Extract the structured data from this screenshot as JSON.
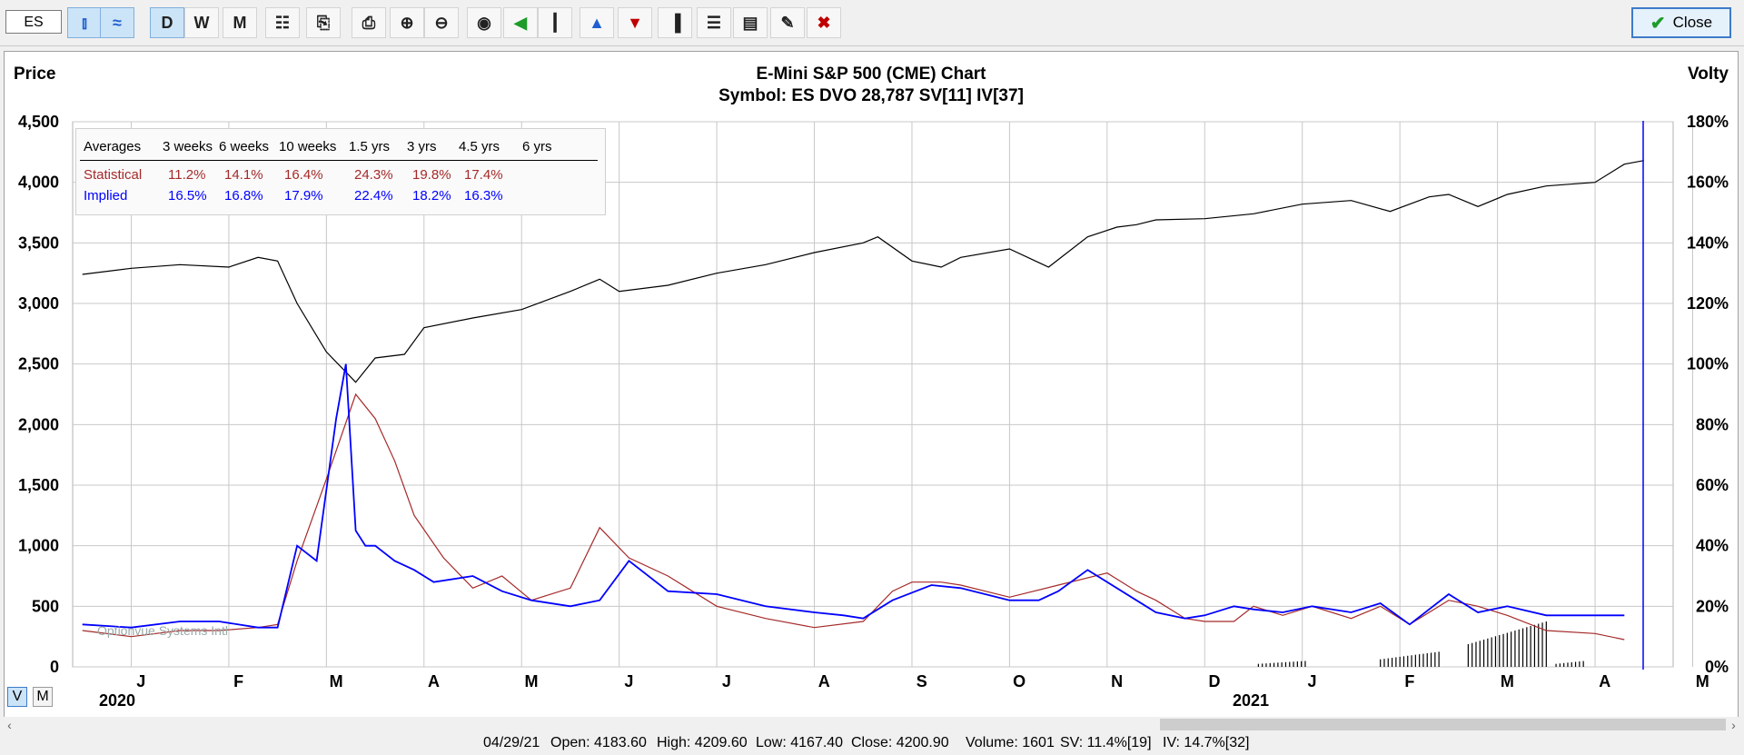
{
  "toolbar": {
    "symbol": "ES",
    "buttons": [
      {
        "name": "bar-chart-button",
        "glyph": "⫾",
        "selected": true
      },
      {
        "name": "line-chart-button",
        "glyph": "≈",
        "selected": true
      },
      {
        "name": "daily-button",
        "glyph": "D",
        "selected": true
      },
      {
        "name": "weekly-button",
        "glyph": "W",
        "selected": false
      },
      {
        "name": "monthly-button",
        "glyph": "M",
        "selected": false
      },
      {
        "name": "chart-settings-button",
        "glyph": "☷",
        "selected": false
      },
      {
        "name": "copy-button",
        "glyph": "⎘",
        "selected": false
      },
      {
        "name": "print-button",
        "glyph": "⎙",
        "selected": false
      },
      {
        "name": "zoom-in-button",
        "glyph": "⊕",
        "selected": false
      },
      {
        "name": "zoom-out-button",
        "glyph": "⊖",
        "selected": false
      },
      {
        "name": "target-button",
        "glyph": "◉",
        "selected": false
      },
      {
        "name": "arrow-button",
        "glyph": "◀",
        "selected": false
      },
      {
        "name": "candles-button",
        "glyph": "┃",
        "selected": false
      },
      {
        "name": "triangle-button",
        "glyph": "▲",
        "selected": false
      },
      {
        "name": "triangle-down-button",
        "glyph": "▼",
        "selected": false
      },
      {
        "name": "volume-bars-button",
        "glyph": "▐",
        "selected": false
      },
      {
        "name": "multi-chart-button",
        "glyph": "☰",
        "selected": false
      },
      {
        "name": "notes-button",
        "glyph": "▤",
        "selected": false
      },
      {
        "name": "draw-pencil-button",
        "glyph": "✎",
        "selected": false
      },
      {
        "name": "delete-button",
        "glyph": "✖",
        "selected": false
      }
    ],
    "close_label": "Close"
  },
  "chart_data": {
    "type": "line",
    "title": "E-Mini S&P 500 (CME) Chart",
    "subtitle": "Symbol: ES  DVO 28,787  SV[11]  IV[37]",
    "ylabel_left": "Price",
    "ylabel_right": "Volty",
    "ylim_left": [
      0,
      4500
    ],
    "ylim_right": [
      0,
      180
    ],
    "yticks_left": [
      "4,500",
      "4,000",
      "3,500",
      "3,000",
      "2,500",
      "2,000",
      "1,500",
      "1,000",
      "500",
      "0"
    ],
    "yticks_right": [
      "180%",
      "160%",
      "140%",
      "120%",
      "100%",
      "80%",
      "60%",
      "40%",
      "20%",
      "0%"
    ],
    "x_months": [
      "J",
      "F",
      "M",
      "A",
      "M",
      "J",
      "J",
      "A",
      "S",
      "O",
      "N",
      "D",
      "J",
      "F",
      "M",
      "A",
      "M"
    ],
    "x_years": [
      "2020",
      "2021"
    ],
    "grid": true,
    "price": {
      "name": "Price",
      "color": "#000000",
      "x": [
        0.0,
        0.5,
        1.0,
        1.5,
        1.8,
        2.0,
        2.2,
        2.5,
        2.8,
        3.0,
        3.3,
        3.5,
        4.0,
        4.5,
        5.0,
        5.3,
        5.5,
        6.0,
        6.5,
        7.0,
        7.5,
        8.0,
        8.15,
        8.5,
        8.8,
        9.0,
        9.5,
        9.9,
        10.3,
        10.6,
        10.8,
        11.0,
        11.5,
        12.0,
        12.5,
        13.0,
        13.4,
        13.8,
        14.0,
        14.3,
        14.6,
        15.0,
        15.5,
        15.8,
        16.0
      ],
      "y": [
        3240,
        3290,
        3320,
        3300,
        3380,
        3350,
        3000,
        2600,
        2350,
        2550,
        2580,
        2800,
        2880,
        2950,
        3100,
        3200,
        3100,
        3150,
        3250,
        3320,
        3420,
        3500,
        3550,
        3350,
        3300,
        3380,
        3450,
        3300,
        3550,
        3630,
        3650,
        3690,
        3700,
        3740,
        3820,
        3850,
        3760,
        3880,
        3900,
        3800,
        3900,
        3970,
        4000,
        4150,
        4180
      ]
    },
    "statistical": {
      "name": "Statistical",
      "color": "#a52a2a",
      "x": [
        0.0,
        0.5,
        1.0,
        1.4,
        1.8,
        2.0,
        2.2,
        2.5,
        2.8,
        3.0,
        3.2,
        3.4,
        3.7,
        4.0,
        4.3,
        4.6,
        5.0,
        5.3,
        5.6,
        6.0,
        6.5,
        7.0,
        7.5,
        8.0,
        8.3,
        8.5,
        8.8,
        9.0,
        9.5,
        10.0,
        10.5,
        10.8,
        11.0,
        11.3,
        11.5,
        11.8,
        12.0,
        12.3,
        12.6,
        13.0,
        13.3,
        13.6,
        14.0,
        14.3,
        14.6,
        15.0,
        15.5,
        15.8
      ],
      "y": [
        12,
        10,
        12,
        12,
        13,
        14,
        35,
        62,
        90,
        82,
        68,
        50,
        36,
        26,
        30,
        22,
        26,
        46,
        36,
        30,
        20,
        16,
        13,
        15,
        25,
        28,
        28,
        27,
        23,
        27,
        31,
        25,
        22,
        16,
        15,
        15,
        20,
        17,
        20,
        16,
        20,
        14,
        22,
        20,
        17,
        12,
        11,
        9
      ]
    },
    "implied": {
      "name": "Implied",
      "color": "#0000ff",
      "x": [
        0.0,
        0.5,
        1.0,
        1.4,
        1.8,
        2.0,
        2.2,
        2.4,
        2.6,
        2.7,
        2.8,
        2.9,
        3.0,
        3.2,
        3.4,
        3.6,
        4.0,
        4.3,
        4.6,
        5.0,
        5.3,
        5.6,
        6.0,
        6.5,
        7.0,
        7.5,
        7.8,
        8.0,
        8.3,
        8.7,
        9.0,
        9.5,
        9.8,
        10.0,
        10.3,
        10.8,
        11.0,
        11.3,
        11.5,
        11.8,
        12.0,
        12.3,
        12.6,
        13.0,
        13.3,
        13.6,
        14.0,
        14.3,
        14.6,
        15.0,
        15.5,
        15.8
      ],
      "y": [
        14,
        13,
        15,
        15,
        13,
        13,
        40,
        35,
        82,
        100,
        45,
        40,
        40,
        35,
        32,
        28,
        30,
        25,
        22,
        20,
        22,
        35,
        25,
        24,
        20,
        18,
        17,
        16,
        22,
        27,
        26,
        22,
        22,
        25,
        32,
        22,
        18,
        16,
        17,
        20,
        19,
        18,
        20,
        18,
        21,
        14,
        24,
        18,
        20,
        17,
        17,
        17
      ]
    },
    "volume_bars": [
      {
        "x_start": 12.05,
        "x_end": 12.55,
        "pct_max": 2
      },
      {
        "x_start": 13.3,
        "x_end": 13.9,
        "pct_max": 5
      },
      {
        "x_start": 14.2,
        "x_end": 15.0,
        "pct_max": 15
      },
      {
        "x_start": 15.1,
        "x_end": 15.4,
        "pct_max": 2
      }
    ],
    "averages_table": {
      "headers": [
        "Averages",
        "3 weeks",
        "6 weeks",
        "10 weeks",
        "1.5 yrs",
        "3 yrs",
        "4.5 yrs",
        "6 yrs"
      ],
      "rows": [
        {
          "label": "Statistical",
          "values": [
            "11.2%",
            "14.1%",
            "16.4%",
            "24.3%",
            "19.8%",
            "17.4%",
            ""
          ],
          "color": "#a52a2a"
        },
        {
          "label": "Implied",
          "values": [
            "16.5%",
            "16.8%",
            "17.9%",
            "22.4%",
            "18.2%",
            "16.3%",
            ""
          ],
          "color": "#0000ff"
        }
      ]
    },
    "watermark": "Optionvue Systems Intl"
  },
  "view_toggle": {
    "v": "V",
    "m": "M"
  },
  "status": {
    "date": "04/29/21",
    "open": "Open: 4183.60",
    "high": "High: 4209.60",
    "low": "Low: 4167.40",
    "close": "Close: 4200.90",
    "volume": "Volume: 1601",
    "sv": "SV: 11.4%[19]",
    "iv": "IV: 14.7%[32]"
  }
}
